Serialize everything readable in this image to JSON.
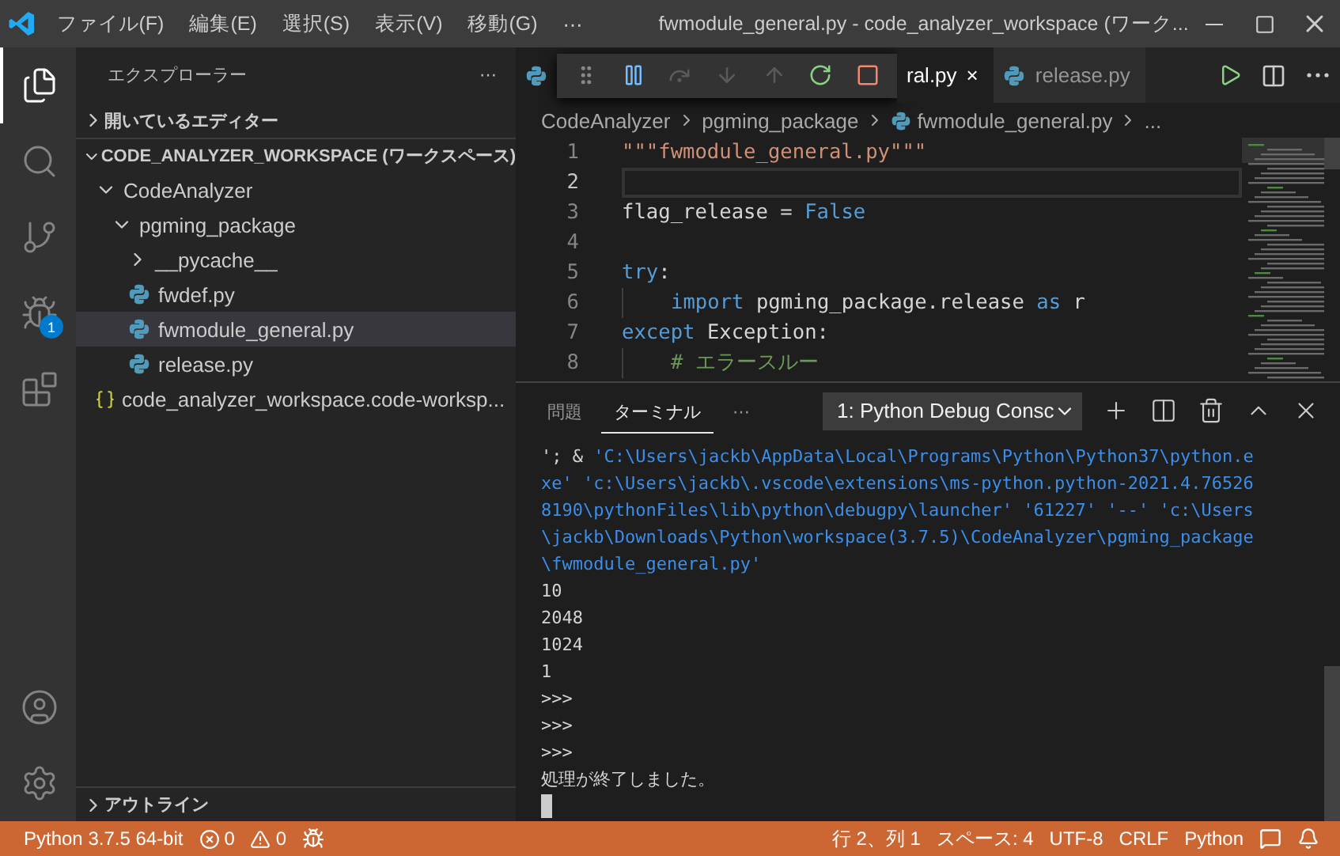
{
  "window": {
    "title": "fwmodule_general.py - code_analyzer_workspace (ワーク...",
    "menu": [
      "ファイル(F)",
      "編集(E)",
      "選択(S)",
      "表示(V)",
      "移動(G)",
      "⋯"
    ]
  },
  "activity_bar": {
    "items": [
      {
        "kind": "files",
        "selected": true
      },
      {
        "kind": "search",
        "selected": false
      },
      {
        "kind": "source-control",
        "selected": false
      },
      {
        "kind": "debug",
        "selected": false,
        "badge": "1"
      },
      {
        "kind": "extensions",
        "selected": false
      }
    ],
    "bottom": [
      {
        "kind": "account"
      },
      {
        "kind": "settings"
      }
    ]
  },
  "sidebar": {
    "title": "エクスプローラー",
    "more": "⋯",
    "sections": [
      {
        "label": "開いているエディター",
        "expanded": false
      },
      {
        "label": "CODE_ANALYZER_WORKSPACE (ワークスペース)",
        "expanded": true
      }
    ],
    "tree": [
      {
        "label": "CodeAnalyzer",
        "kind": "folder",
        "expanded": true,
        "selected": false,
        "children": [
          {
            "label": "pgming_package",
            "kind": "folder",
            "expanded": true,
            "selected": false,
            "children": [
              {
                "label": "__pycache__",
                "kind": "folder",
                "expanded": false,
                "selected": false
              },
              {
                "label": "fwdef.py",
                "kind": "python",
                "selected": false
              },
              {
                "label": "fwmodule_general.py",
                "kind": "python",
                "selected": true
              },
              {
                "label": "release.py",
                "kind": "python",
                "selected": false
              }
            ]
          }
        ]
      },
      {
        "label": "code_analyzer_workspace.code-worksp...",
        "kind": "workspace",
        "selected": false
      }
    ],
    "outline": {
      "label": "アウトライン",
      "expanded": false
    }
  },
  "editor": {
    "tabs": [
      {
        "label": "ral.py",
        "selected": true,
        "close": "×"
      },
      {
        "label": "release.py",
        "selected": false
      }
    ],
    "debug_toolbar": [
      {
        "kind": "grip",
        "disabled": false
      },
      {
        "kind": "pause",
        "disabled": false
      },
      {
        "kind": "step-over",
        "disabled": true
      },
      {
        "kind": "step-into",
        "disabled": true
      },
      {
        "kind": "step-out",
        "disabled": true
      },
      {
        "kind": "restart",
        "disabled": false
      },
      {
        "kind": "stop",
        "disabled": false
      }
    ],
    "breadcrumb": [
      {
        "label": "CodeAnalyzer",
        "kind": "folder"
      },
      {
        "label": "pgming_package",
        "kind": "folder"
      },
      {
        "label": "fwmodule_general.py",
        "kind": "python"
      },
      {
        "label": "...",
        "kind": "more"
      }
    ],
    "lines": [
      {
        "number": "1",
        "current": false,
        "tokens": [
          {
            "text": "\"\"\"fwmodule_general.py\"\"\"",
            "kind": "string"
          }
        ]
      },
      {
        "number": "2",
        "current": true
      },
      {
        "number": "3",
        "current": false,
        "tokens": [
          {
            "text": "flag_release = ",
            "kind": "plain"
          },
          {
            "text": "False",
            "kind": "keyword"
          }
        ]
      },
      {
        "number": "4",
        "current": false
      },
      {
        "number": "5",
        "current": false,
        "tokens": [
          {
            "text": "try",
            "kind": "keyword"
          },
          {
            "text": ":",
            "kind": "plain"
          }
        ]
      },
      {
        "number": "6",
        "current": false,
        "indented": true,
        "tokens": [
          {
            "text": "import",
            "kind": "keyword"
          },
          {
            "text": " pgming_package.release ",
            "kind": "plain"
          },
          {
            "text": "as",
            "kind": "keyword"
          },
          {
            "text": " r",
            "kind": "plain"
          }
        ]
      },
      {
        "number": "7",
        "current": false,
        "tokens": [
          {
            "text": "except",
            "kind": "keyword"
          },
          {
            "text": " Exception:",
            "kind": "plain"
          }
        ]
      },
      {
        "number": "8",
        "current": false,
        "indented": true,
        "tokens": [
          {
            "text": "# エラースルー",
            "kind": "comment"
          }
        ]
      }
    ]
  },
  "panel": {
    "tabs": [
      {
        "label": "問題",
        "selected": false
      },
      {
        "label": "ターミナル",
        "selected": true
      }
    ],
    "more": "⋯",
    "terminal_select": "1: Python Debug Consc",
    "actions": [
      {
        "kind": "add"
      },
      {
        "kind": "split"
      },
      {
        "kind": "delete"
      },
      {
        "kind": "maximize"
      },
      {
        "kind": "close"
      }
    ],
    "terminal": [
      [
        {
          "text": "'; & ",
          "kind": "plain"
        },
        {
          "text": "'C:\\Users\\jackb\\AppData\\Local\\Programs\\Python\\Python37\\python.e",
          "kind": "path"
        }
      ],
      [
        {
          "text": "xe' 'c:\\Users\\jackb\\.vscode\\extensions\\ms-python.python-2021.4.76526",
          "kind": "path"
        }
      ],
      [
        {
          "text": "8190\\pythonFiles\\lib\\python\\debugpy\\launcher' '61227' '--' 'c:\\Users",
          "kind": "path"
        }
      ],
      [
        {
          "text": "\\jackb\\Downloads\\Python\\workspace(3.7.5)\\CodeAnalyzer\\pgming_package",
          "kind": "path"
        }
      ],
      [
        {
          "text": "\\fwmodule_general.py'",
          "kind": "path"
        }
      ],
      [
        {
          "text": "10",
          "kind": "plain"
        }
      ],
      [
        {
          "text": "2048",
          "kind": "plain"
        }
      ],
      [
        {
          "text": "1024",
          "kind": "plain"
        }
      ],
      [
        {
          "text": "1",
          "kind": "plain"
        }
      ],
      [
        {
          "text": ">>>",
          "kind": "plain"
        }
      ],
      [
        {
          "text": ">>>",
          "kind": "plain"
        }
      ],
      [
        {
          "text": ">>>",
          "kind": "plain"
        }
      ],
      [
        {
          "text": "処理が終了しました。",
          "kind": "plain"
        }
      ]
    ]
  },
  "status_bar": {
    "left": [
      {
        "kind": "text",
        "text": "Python 3.7.5 64-bit"
      },
      {
        "kind": "errors",
        "text": "0"
      },
      {
        "kind": "warnings",
        "text": "0"
      },
      {
        "kind": "debug"
      }
    ],
    "right": [
      {
        "kind": "text",
        "text": "行 2、列 1"
      },
      {
        "kind": "text",
        "text": "スペース: 4"
      },
      {
        "kind": "text",
        "text": "UTF-8"
      },
      {
        "kind": "text",
        "text": "CRLF"
      },
      {
        "kind": "text",
        "text": "Python"
      },
      {
        "kind": "feedback"
      },
      {
        "kind": "bell"
      }
    ]
  }
}
